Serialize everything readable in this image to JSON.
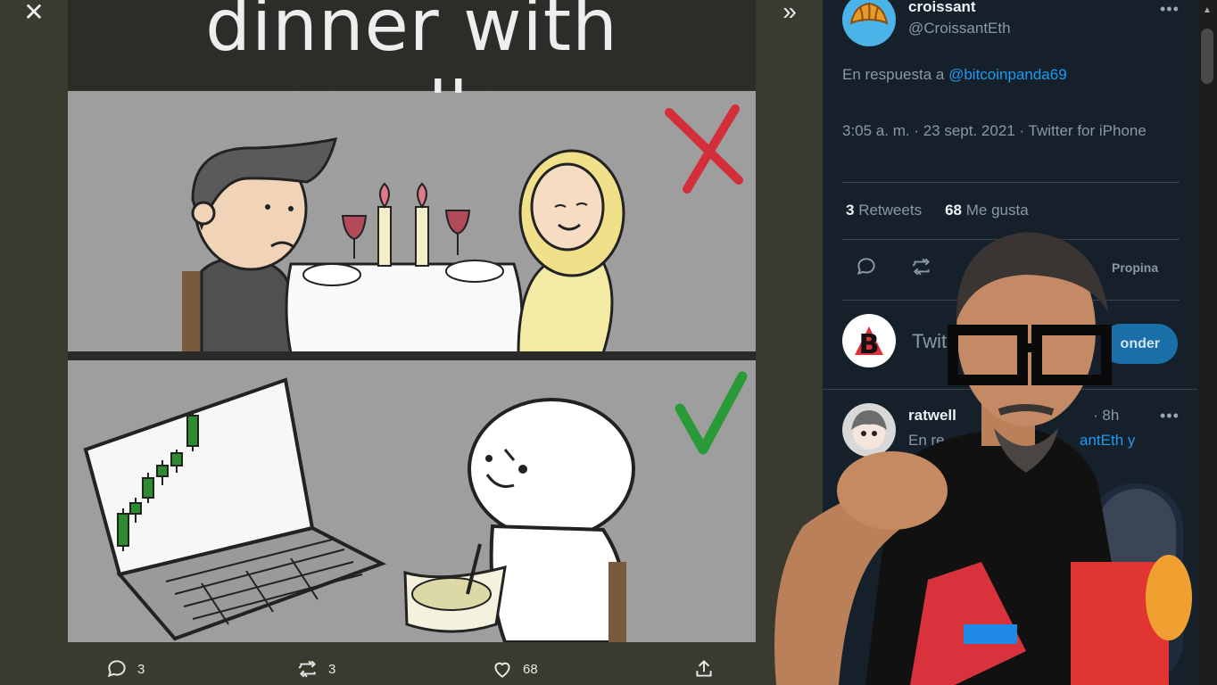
{
  "viewer": {
    "close_glyph": "✕",
    "expand_glyph": "»"
  },
  "meme": {
    "title": "dinner with candles"
  },
  "tweet_actions": {
    "reply_count": "3",
    "retweet_count": "3",
    "like_count": "68"
  },
  "tweet": {
    "author_name": "croissant",
    "author_handle": "@CroissantEth",
    "more_glyph": "•••",
    "reply_prefix": "En respuesta a ",
    "reply_to_handle": "@bitcoinpanda69",
    "timestamp": "3:05 a. m. · 23 sept. 2021 · Twitter for iPhone",
    "retweets_count": "3",
    "retweets_label": "Retweets",
    "likes_count": "68",
    "likes_label": "Me gusta",
    "tip_label": "Propina"
  },
  "reply_box": {
    "placeholder": "Twit",
    "button_label": "onder"
  },
  "reply_item": {
    "name": "ratwell",
    "time": "· 8h",
    "prefix": "En re",
    "link_text": "antEth y",
    "more_glyph": "•••"
  },
  "colors": {
    "panel_bg": "#15202b",
    "accent": "#1d9bf0",
    "meme_title_band": "#2c2d28",
    "candle_green": "#2e8b2e",
    "cross_red": "#d32f3a",
    "check_green": "#2a9a38"
  },
  "icons": [
    "close-icon",
    "expand-icon",
    "reply-icon",
    "retweet-icon",
    "like-icon",
    "share-icon",
    "more-icon"
  ]
}
